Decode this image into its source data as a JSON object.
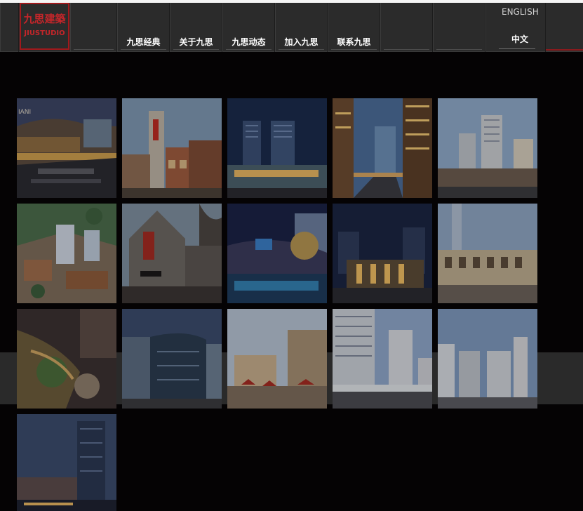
{
  "logo": {
    "cn": "九思建築",
    "en": "JIUSTUDIO"
  },
  "nav": [
    {
      "label": "九思经典"
    },
    {
      "label": "关于九思"
    },
    {
      "label": "九思动态"
    },
    {
      "label": "加入九思"
    },
    {
      "label": "联系九思"
    }
  ],
  "lang": {
    "english": "ENGLISH",
    "chinese": "中文"
  },
  "colors": {
    "brand_red": "#c3262a",
    "header_bg": "#2b2b2b",
    "page_bg": "#050304"
  },
  "gallery": [
    {
      "name": "project-thumb-shopping-plaza"
    },
    {
      "name": "project-thumb-street-tower"
    },
    {
      "name": "project-thumb-night-highrise"
    },
    {
      "name": "project-thumb-evening-avenue"
    },
    {
      "name": "project-thumb-residential-towers"
    },
    {
      "name": "project-thumb-aerial-complex"
    },
    {
      "name": "project-thumb-brick-gable"
    },
    {
      "name": "project-thumb-night-mall"
    },
    {
      "name": "project-thumb-lit-facade"
    },
    {
      "name": "project-thumb-classic-arcade"
    },
    {
      "name": "project-thumb-aerial-garden"
    },
    {
      "name": "project-thumb-glass-mall"
    },
    {
      "name": "project-thumb-market-square"
    },
    {
      "name": "project-thumb-highrise-street"
    },
    {
      "name": "project-thumb-city-blocks"
    },
    {
      "name": "project-thumb-dusk-tower"
    }
  ]
}
